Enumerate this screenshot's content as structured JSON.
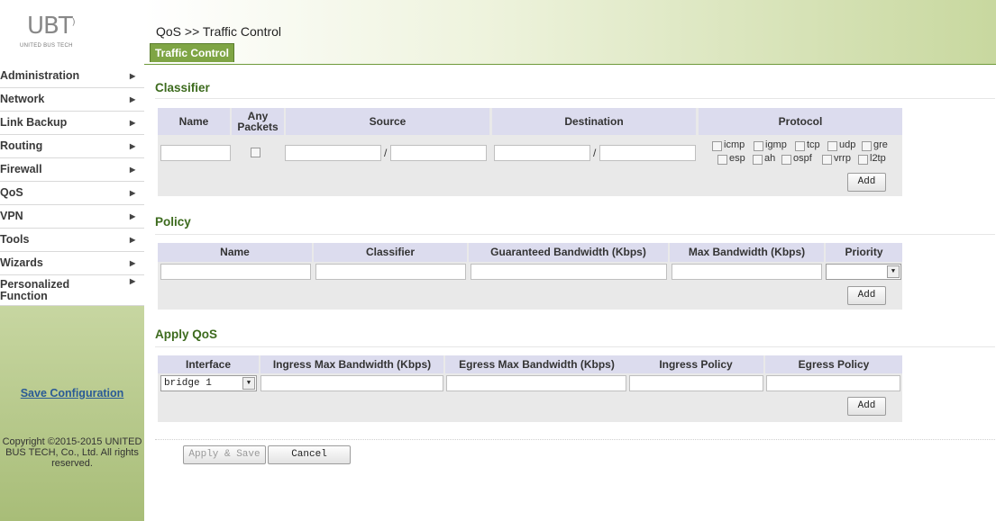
{
  "logo": {
    "mark": "UBT",
    "sub": "UNITED BUS TECH"
  },
  "menu": [
    {
      "label": "Administration"
    },
    {
      "label": "Network"
    },
    {
      "label": "Link Backup"
    },
    {
      "label": "Routing"
    },
    {
      "label": "Firewall"
    },
    {
      "label": "QoS"
    },
    {
      "label": "VPN"
    },
    {
      "label": "Tools"
    },
    {
      "label": "Wizards"
    },
    {
      "label": "Personalized Function"
    }
  ],
  "save_config": "Save Configuration",
  "copyright": "Copyright ©2015-2015 UNITED BUS TECH, Co., Ltd. All rights reserved.",
  "breadcrumb": "QoS >> Traffic Control",
  "tab": "Traffic Control",
  "classifier": {
    "title": "Classifier",
    "headers": {
      "name": "Name",
      "any_packets": "Any Packets",
      "source": "Source",
      "destination": "Destination",
      "protocol": "Protocol"
    },
    "slash": "/",
    "protocols": [
      "icmp",
      "igmp",
      "tcp",
      "udp",
      "gre",
      "esp",
      "ah",
      "ospf",
      "vrrp",
      "l2tp"
    ],
    "add": "Add"
  },
  "policy": {
    "title": "Policy",
    "headers": {
      "name": "Name",
      "classifier": "Classifier",
      "guaranteed": "Guaranteed Bandwidth (Kbps)",
      "max": "Max Bandwidth (Kbps)",
      "priority": "Priority"
    },
    "priority_value": "",
    "add": "Add"
  },
  "apply": {
    "title": "Apply QoS",
    "headers": {
      "interface": "Interface",
      "ingress_max": "Ingress Max Bandwidth (Kbps)",
      "egress_max": "Egress Max Bandwidth (Kbps)",
      "ingress_policy": "Ingress Policy",
      "egress_policy": "Egress Policy"
    },
    "interface_value": "bridge 1",
    "add": "Add"
  },
  "footer": {
    "apply_save": "Apply & Save",
    "cancel": "Cancel"
  }
}
